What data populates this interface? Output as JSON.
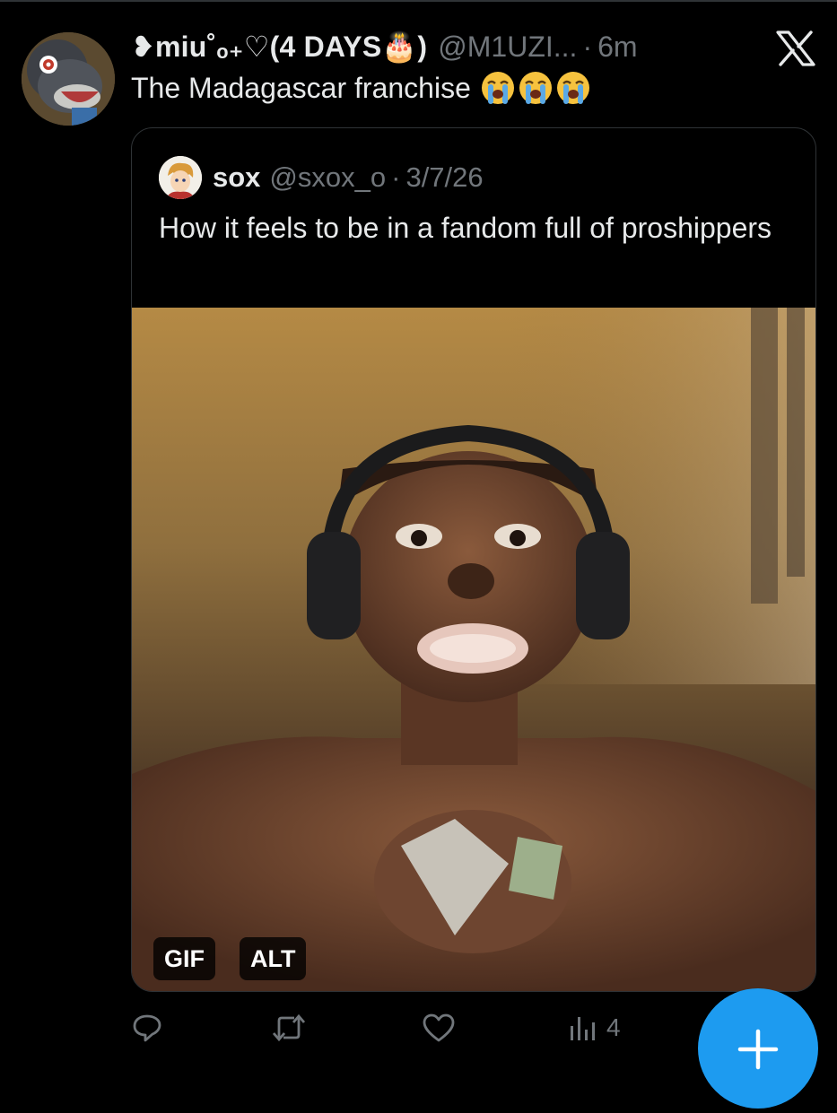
{
  "tweet": {
    "display_name": "❥miu˚ₒ₊♡(4 DAYS🎂)",
    "handle": "@M1UZI...",
    "separator": "·",
    "time": "6m",
    "text": "The Madagascar franchise",
    "emoji_count_shown": 3,
    "platform_icon": "x-logo-icon"
  },
  "quote": {
    "display_name": "sox",
    "handle": "@sxox_o",
    "separator": "·",
    "date": "3/7/26",
    "text": "How it feels to be in a fandom full of proshippers",
    "media_badges": [
      "GIF",
      "ALT"
    ]
  },
  "actions": {
    "reply_icon": "reply-icon",
    "retweet_icon": "retweet-icon",
    "like_icon": "heart-icon",
    "views_icon": "views-icon",
    "views_count": "4"
  },
  "compose_icon": "plus-icon",
  "colors": {
    "background": "#000000",
    "text_primary": "#e7e9ea",
    "text_secondary": "#71767b",
    "border": "#2f3336",
    "accent": "#1d9bf0"
  }
}
